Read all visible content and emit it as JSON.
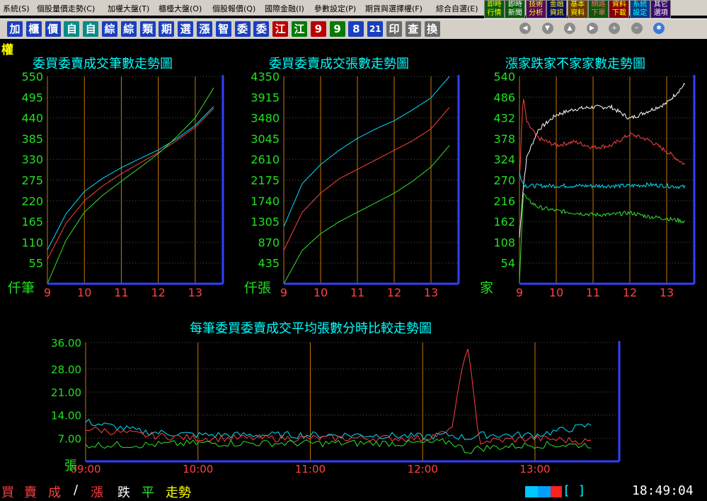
{
  "menu": [
    "系統(S)",
    "個股量價走勢(C)",
    "加權大盤(T)",
    "櫃檯大盤(O)",
    "個股報價(Q)",
    "國際金融(I)",
    "參數設定(P)",
    "期貨與選擇權(F)",
    "綜合自選(E)"
  ],
  "quick_buttons": [
    {
      "l1": "即時",
      "l2": "行情",
      "bg": "#0a5a0a",
      "fg": "#ffff00"
    },
    {
      "l1": "即時",
      "l2": "新聞",
      "bg": "#0a5a0a",
      "fg": "#ffffff"
    },
    {
      "l1": "技術",
      "l2": "分析",
      "bg": "#5a0a5a",
      "fg": "#ffff00"
    },
    {
      "l1": "金融",
      "l2": "資訊",
      "bg": "#0a0a6a",
      "fg": "#ffff00"
    },
    {
      "l1": "基本",
      "l2": "資料",
      "bg": "#6a3a00",
      "fg": "#ffff00"
    },
    {
      "l1": "網路",
      "l2": "下單",
      "bg": "#0a5a0a",
      "fg": "#ff6a6a"
    },
    {
      "l1": "資料",
      "l2": "下載",
      "bg": "#8a0000",
      "fg": "#ffff00"
    },
    {
      "l1": "系統",
      "l2": "設定",
      "bg": "#0a3a8a",
      "fg": "#00ffff"
    },
    {
      "l1": "其它",
      "l2": "選項",
      "bg": "#3a0a6a",
      "fg": "#ffffff"
    }
  ],
  "toolbar": [
    {
      "t": "加",
      "c": ""
    },
    {
      "t": "櫃",
      "c": ""
    },
    {
      "t": "價",
      "c": ""
    },
    {
      "t": "自",
      "c": "cy"
    },
    {
      "t": "自",
      "c": "cy"
    },
    {
      "t": "綜",
      "c": ""
    },
    {
      "t": "綜",
      "c": ""
    },
    {
      "t": "類",
      "c": ""
    },
    {
      "t": "期",
      "c": ""
    },
    {
      "t": "選",
      "c": ""
    },
    {
      "t": "漲",
      "c": ""
    },
    {
      "t": "智",
      "c": ""
    },
    {
      "t": "委",
      "c": ""
    },
    {
      "t": "委",
      "c": ""
    },
    {
      "t": "江",
      "c": "rd"
    },
    {
      "t": "江",
      "c": "gr"
    },
    {
      "t": "9",
      "c": "rd"
    },
    {
      "t": "9",
      "c": "gr"
    },
    {
      "t": "8",
      "c": ""
    },
    {
      "t": "21",
      "c": ""
    },
    {
      "t": "印",
      "c": "gy"
    },
    {
      "t": "查",
      "c": "gy"
    },
    {
      "t": "換",
      "c": "gy"
    }
  ],
  "nav_buttons": [
    "◀",
    "▼",
    "▲",
    "▶",
    "+",
    "−",
    "✱"
  ],
  "side_label": "權",
  "colors": {
    "cyan": "#00e0ff",
    "red": "#ff4040",
    "green": "#30e030",
    "white": "#ffffff",
    "blue": "#3040ff",
    "orange": "#c87800",
    "axis_green": "#20e020",
    "time_red": "#ff4040"
  },
  "charts": {
    "c1": {
      "title": "委買委賣成交筆數走勢圖",
      "unit": "仟筆",
      "yticks": [
        "550",
        "495",
        "440",
        "385",
        "330",
        "275",
        "220",
        "165",
        "110",
        "55"
      ],
      "xticks": [
        "9",
        "10",
        "11",
        "12",
        "13"
      ]
    },
    "c2": {
      "title": "委買委賣成交張數走勢圖",
      "unit": "仟張",
      "yticks": [
        "4350",
        "3915",
        "3480",
        "3045",
        "2610",
        "2175",
        "1740",
        "1305",
        "870",
        "435"
      ],
      "xticks": [
        "9",
        "10",
        "11",
        "12",
        "13"
      ]
    },
    "c3": {
      "title": "漲家跌家不家家數走勢圖",
      "unit": "家",
      "yticks": [
        "540",
        "486",
        "432",
        "378",
        "324",
        "270",
        "216",
        "162",
        "108",
        "54"
      ],
      "xticks": [
        "9",
        "10",
        "11",
        "12",
        "13"
      ]
    },
    "c4": {
      "title": "每筆委買委賣成交平均張數分時比較走勢圖",
      "unit": "張",
      "yticks": [
        "36.00",
        "28.00",
        "21.00",
        "14.00",
        "7.00"
      ],
      "xticks": [
        "09:00",
        "10:00",
        "11:00",
        "12:00",
        "13:00"
      ]
    }
  },
  "footer": [
    {
      "t": "買",
      "c": "#ff4040"
    },
    {
      "t": "賣",
      "c": "#ff4040"
    },
    {
      "t": "成",
      "c": "#ff4040"
    },
    {
      "t": "/",
      "c": "#ffffff"
    },
    {
      "t": "漲",
      "c": "#ff4040"
    },
    {
      "t": "跌",
      "c": "#ffffff"
    },
    {
      "t": "平",
      "c": "#30e030"
    },
    {
      "t": "走勢",
      "c": "#ffff00"
    }
  ],
  "clock": "18:49:04",
  "clock_bracket": "[          ]",
  "chart_data": [
    {
      "type": "line",
      "title": "委買委賣成交筆數走勢圖",
      "ylabel": "仟筆",
      "x": [
        9,
        9.5,
        10,
        10.5,
        11,
        11.5,
        12,
        12.5,
        13,
        13.5
      ],
      "ylim": [
        0,
        550
      ],
      "series": [
        {
          "values": [
            90,
            185,
            245,
            280,
            308,
            332,
            355,
            385,
            420,
            470
          ]
        },
        {
          "values": [
            65,
            160,
            220,
            260,
            292,
            320,
            348,
            380,
            415,
            465
          ]
        },
        {
          "values": [
            0,
            115,
            190,
            235,
            272,
            308,
            345,
            390,
            440,
            520
          ]
        }
      ]
    },
    {
      "type": "line",
      "title": "委買委賣成交張數走勢圖",
      "ylabel": "仟張",
      "x": [
        9,
        9.5,
        10,
        10.5,
        11,
        11.5,
        12,
        12.5,
        13,
        13.5
      ],
      "ylim": [
        0,
        4350
      ],
      "series": [
        {
          "values": [
            1200,
            2100,
            2500,
            2800,
            3050,
            3250,
            3420,
            3650,
            3900,
            4350
          ]
        },
        {
          "values": [
            700,
            1500,
            1900,
            2200,
            2400,
            2600,
            2800,
            3000,
            3250,
            3700
          ]
        },
        {
          "values": [
            0,
            700,
            1050,
            1300,
            1500,
            1700,
            1900,
            2150,
            2450,
            2900
          ]
        }
      ]
    },
    {
      "type": "line",
      "title": "漲家跌家不家家數走勢圖",
      "ylabel": "家",
      "x": [
        9,
        9.1,
        9.2,
        9.5,
        10,
        10.5,
        11,
        11.5,
        12,
        12.5,
        13,
        13.5
      ],
      "ylim": [
        0,
        540
      ],
      "series": [
        {
          "values": [
            120,
            250,
            330,
            400,
            440,
            455,
            460,
            460,
            430,
            450,
            470,
            520
          ]
        },
        {
          "values": [
            270,
            490,
            420,
            380,
            360,
            370,
            355,
            360,
            390,
            375,
            345,
            310
          ]
        },
        {
          "values": [
            290,
            260,
            255,
            255,
            255,
            255,
            255,
            255,
            255,
            258,
            255,
            252
          ]
        },
        {
          "values": [
            0,
            240,
            220,
            200,
            190,
            185,
            180,
            180,
            185,
            175,
            170,
            162
          ]
        }
      ]
    },
    {
      "type": "line",
      "title": "每筆委買委賣成交平均張數分時比較走勢圖",
      "ylabel": "張",
      "x": [
        9,
        9.5,
        10,
        10.5,
        11,
        11.5,
        12,
        12.25,
        12.4,
        12.5,
        13,
        13.5
      ],
      "ylim": [
        0,
        36
      ],
      "series": [
        {
          "values": [
            12,
            9,
            8,
            8,
            8,
            8,
            7.5,
            8,
            7,
            8,
            8,
            11
          ]
        },
        {
          "values": [
            10,
            8,
            7,
            7,
            7,
            7,
            7,
            9,
            36,
            6,
            7,
            6
          ]
        },
        {
          "values": [
            5,
            5,
            5.5,
            5.5,
            5.5,
            5.5,
            5.5,
            6,
            3,
            4,
            5,
            5
          ]
        }
      ]
    }
  ]
}
